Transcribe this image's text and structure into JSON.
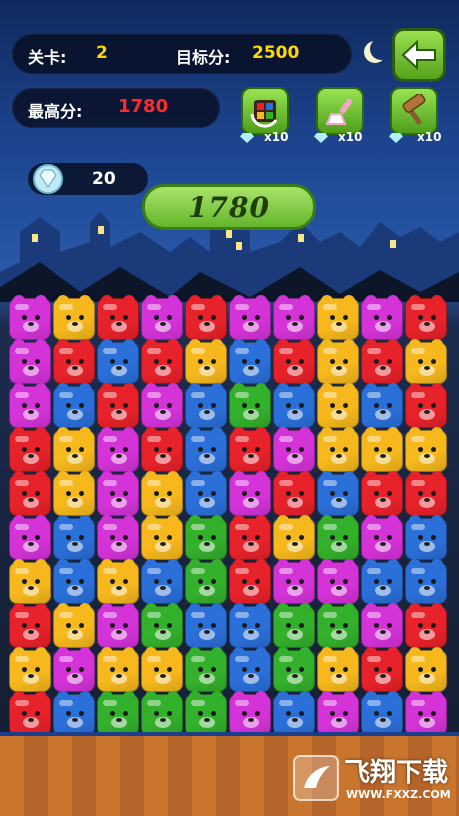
{
  "hud": {
    "level_label": "关卡:",
    "level_value": "2",
    "target_label": "目标分:",
    "target_value": "2500",
    "best_label": "最高分:",
    "best_value": "1780",
    "diamonds": "20",
    "score": "1780"
  },
  "tools": [
    {
      "name": "refresh",
      "count": "x10"
    },
    {
      "name": "brush",
      "count": "x10"
    },
    {
      "name": "hammer",
      "count": "x10"
    }
  ],
  "colors": {
    "R": "#e8222a",
    "Y": "#f6b81c",
    "P": "#d433d8",
    "B": "#2b6fd9",
    "G": "#33b02c"
  },
  "board": [
    [
      "P",
      "Y",
      "R",
      "P",
      "R",
      "P",
      "P",
      "Y",
      "P",
      "R"
    ],
    [
      "P",
      "R",
      "B",
      "R",
      "Y",
      "B",
      "R",
      "Y",
      "R",
      "Y"
    ],
    [
      "P",
      "B",
      "R",
      "P",
      "B",
      "G",
      "B",
      "Y",
      "B",
      "R"
    ],
    [
      "R",
      "Y",
      "P",
      "R",
      "B",
      "R",
      "P",
      "Y",
      "Y",
      "Y"
    ],
    [
      "R",
      "Y",
      "P",
      "Y",
      "B",
      "P",
      "R",
      "B",
      "R",
      "R"
    ],
    [
      "P",
      "B",
      "P",
      "Y",
      "G",
      "R",
      "Y",
      "G",
      "P",
      "B"
    ],
    [
      "Y",
      "B",
      "Y",
      "B",
      "G",
      "R",
      "P",
      "P",
      "B",
      "B"
    ],
    [
      "R",
      "Y",
      "P",
      "G",
      "B",
      "B",
      "G",
      "G",
      "P",
      "R"
    ],
    [
      "Y",
      "P",
      "Y",
      "Y",
      "G",
      "B",
      "G",
      "Y",
      "R",
      "Y"
    ],
    [
      "R",
      "B",
      "G",
      "G",
      "G",
      "P",
      "B",
      "P",
      "B",
      "P"
    ]
  ],
  "watermark": {
    "text": "飞翔下载",
    "url": "WWW.FXXZ.COM"
  }
}
